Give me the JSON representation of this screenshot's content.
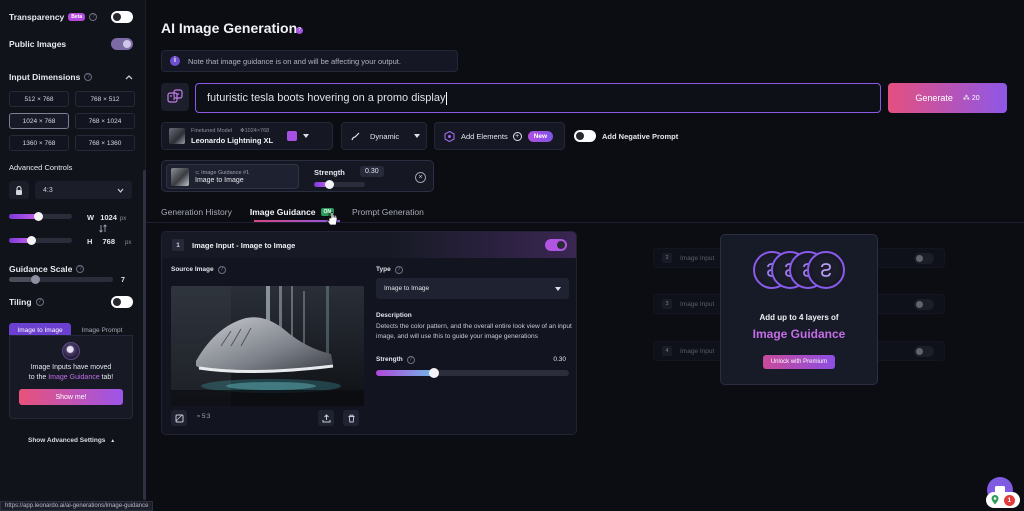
{
  "sidebar": {
    "transparency": {
      "label": "Transparency",
      "badge": "Beta",
      "enabled": false
    },
    "public_images": {
      "label": "Public Images",
      "enabled": true
    },
    "input_dimensions": {
      "label": "Input Dimensions",
      "options": [
        "512 × 768",
        "768 × 512",
        "1024 × 768",
        "768 × 1024",
        "1360 × 768",
        "768 × 1360"
      ],
      "selected": "1024 × 768"
    },
    "advanced_controls": {
      "label": "Advanced Controls",
      "aspect_ratio": "4:3",
      "width_label": "W",
      "width_value": "1024",
      "height_label": "H",
      "height_value": "768",
      "unit": "px",
      "width_fraction": 0.47,
      "height_fraction": 0.35
    },
    "guidance_scale": {
      "label": "Guidance Scale",
      "value": "7",
      "fraction": 0.25
    },
    "tiling": {
      "label": "Tiling",
      "enabled": false
    },
    "image_tabs": [
      "Image to Image",
      "Image Prompt"
    ],
    "moved_notice": {
      "line1": "Image Inputs have moved",
      "line2_prefix": "to the ",
      "line2_accent": "Image Guidance",
      "line2_suffix": " tab!",
      "button": "Show me!"
    },
    "show_advanced": "Show Advanced Settings"
  },
  "status_url": "https://app.leonardo.ai/ai-generations/image-guidance",
  "main": {
    "title": "AI Image Generation",
    "notice": "Note that image guidance is on and will be affecting your output.",
    "prompt": "futuristic tesla boots hovering on a promo display",
    "generate": {
      "label": "Generate",
      "cost": "20"
    },
    "model": {
      "caption": "Finetuned Model",
      "dims": "1024×768",
      "name": "Leonardo Lightning XL"
    },
    "style": "Dynamic",
    "add_elements": {
      "label": "Add Elements",
      "badge": "New"
    },
    "negative_prompt": {
      "label": "Add Negative Prompt",
      "enabled": false
    },
    "guidance_chip": {
      "caption": "Image Guidance #1",
      "name": "Image to Image",
      "strength_label": "Strength",
      "strength_value": "0.30",
      "strength_fraction": 0.3
    },
    "tabs": [
      {
        "label": "Generation History"
      },
      {
        "label": "Image Guidance",
        "badge": "ON"
      },
      {
        "label": "Prompt Generation"
      }
    ],
    "panel": {
      "number": "1",
      "title": "Image Input - Image to Image",
      "enabled": true,
      "source_label": "Source Image",
      "ratio": "≈ 5:3",
      "type_label": "Type",
      "type_value": "Image to Image",
      "description_label": "Description",
      "description": "Detects the color pattern, and the overall entire look view of an input image, and will use this to guide your image generations",
      "strength_label": "Strength",
      "strength_value": "0.30",
      "strength_fraction": 0.3
    },
    "placeholder_rows": [
      {
        "number": "2",
        "label": "Image Input"
      },
      {
        "number": "3",
        "label": "Image Input"
      },
      {
        "number": "4",
        "label": "Image Input"
      }
    ],
    "premium": {
      "line1": "Add up to 4 layers of",
      "line2": "Image Guidance",
      "button": "Unlock with Premium"
    }
  },
  "notifications": {
    "count": "1"
  },
  "colors": {
    "accent": "#8b59e6",
    "pink": "#e5507f",
    "on_badge": "#2b9a5a"
  }
}
